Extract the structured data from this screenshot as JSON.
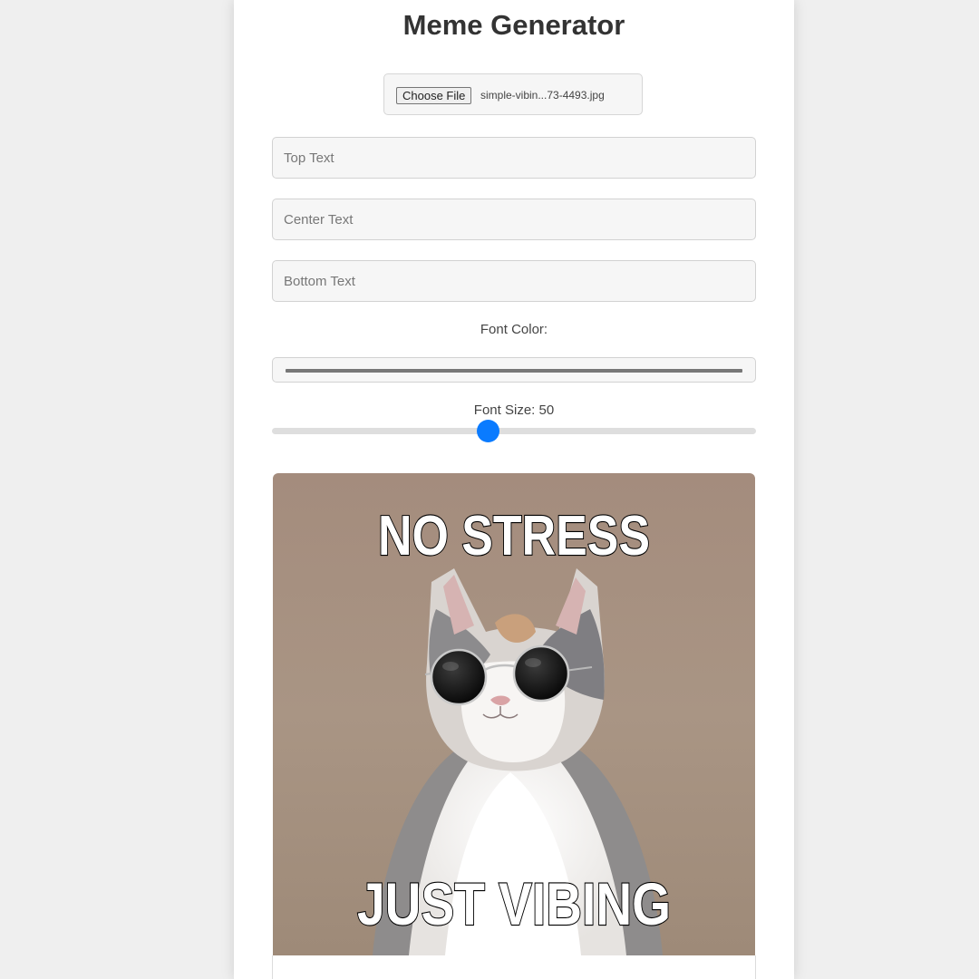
{
  "app": {
    "title": "Meme Generator"
  },
  "file_input": {
    "button_label": "Choose File",
    "file_name": "simple-vibin...73-4493.jpg"
  },
  "inputs": {
    "top_placeholder": "Top Text",
    "center_placeholder": "Center Text",
    "bottom_placeholder": "Bottom Text"
  },
  "font_color": {
    "label": "Font Color:",
    "value": "#777777"
  },
  "font_size": {
    "label": "Font Size: 50",
    "value": 50,
    "min": 10,
    "max": 100
  },
  "meme": {
    "top_caption": "NO STRESS",
    "bottom_caption": "JUST VIBING",
    "subject": "cat wearing round sunglasses"
  },
  "colors": {
    "accent": "#0a7bff",
    "background": "#efefef",
    "card": "#ffffff"
  }
}
